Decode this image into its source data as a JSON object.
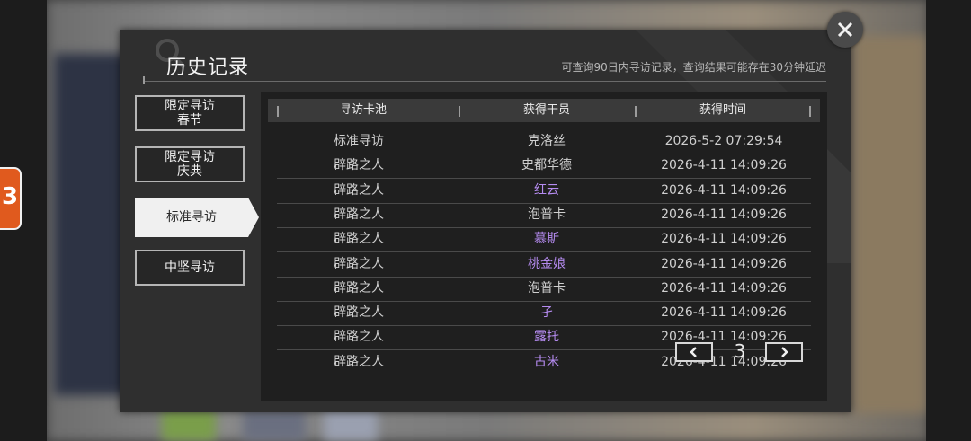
{
  "modal": {
    "title": "历史记录",
    "notice": "可查询90日内寻访记录，查询结果可能存在30分钟延迟"
  },
  "tabs": [
    {
      "line1": "限定寻访",
      "line2": "春节",
      "active": false
    },
    {
      "line1": "限定寻访",
      "line2": "庆典",
      "active": false
    },
    {
      "line1": "标准寻访",
      "line2": "",
      "active": true
    },
    {
      "line1": "中坚寻访",
      "line2": "",
      "active": false
    }
  ],
  "table": {
    "headers": [
      "寻访卡池",
      "获得干员",
      "获得时间"
    ],
    "rows": [
      {
        "pool": "标准寻访",
        "operator": "克洛丝",
        "time": "2026-5-2 07:29:54",
        "rare": false
      },
      {
        "pool": "辟路之人",
        "operator": "史都华德",
        "time": "2026-4-11 14:09:26",
        "rare": false
      },
      {
        "pool": "辟路之人",
        "operator": "红云",
        "time": "2026-4-11 14:09:26",
        "rare": true
      },
      {
        "pool": "辟路之人",
        "operator": "泡普卡",
        "time": "2026-4-11 14:09:26",
        "rare": false
      },
      {
        "pool": "辟路之人",
        "operator": "慕斯",
        "time": "2026-4-11 14:09:26",
        "rare": true
      },
      {
        "pool": "辟路之人",
        "operator": "桃金娘",
        "time": "2026-4-11 14:09:26",
        "rare": true
      },
      {
        "pool": "辟路之人",
        "operator": "泡普卡",
        "time": "2026-4-11 14:09:26",
        "rare": false
      },
      {
        "pool": "辟路之人",
        "operator": "孑",
        "time": "2026-4-11 14:09:26",
        "rare": true
      },
      {
        "pool": "辟路之人",
        "operator": "露托",
        "time": "2026-4-11 14:09:26",
        "rare": true
      },
      {
        "pool": "辟路之人",
        "operator": "古米",
        "time": "2026-4-11 14:09:26",
        "rare": true
      }
    ]
  },
  "pagination": {
    "page": "3"
  },
  "colors": {
    "rare": "#b58bf0",
    "normal": "#cfcfcf",
    "accent": "#f0f0f0"
  },
  "icons": {
    "close": "close-icon",
    "prev": "chevron-left-icon",
    "next": "chevron-right-icon"
  }
}
